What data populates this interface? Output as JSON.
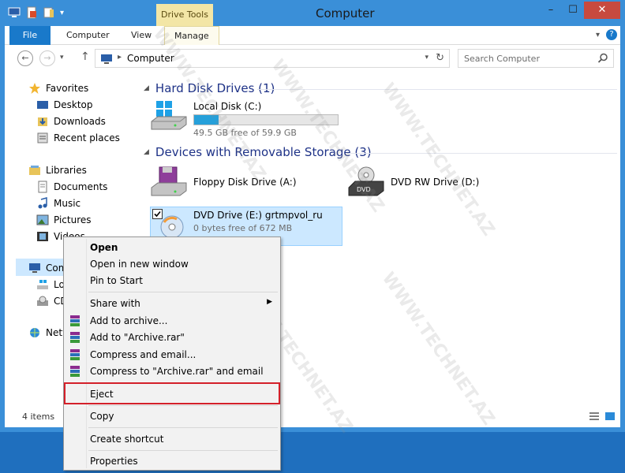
{
  "window": {
    "title": "Computer",
    "contextual_tab": "Drive Tools",
    "controls": {
      "minimize": "–",
      "maximize": "☐",
      "close": "✕"
    }
  },
  "ribbon": {
    "tabs": [
      "File",
      "Computer",
      "View",
      "Manage"
    ],
    "help": "?"
  },
  "address": {
    "path": "Computer",
    "search_placeholder": "Search Computer"
  },
  "sidebar": {
    "items": [
      "Favorites",
      "Desktop",
      "Downloads",
      "Recent places",
      "Libraries",
      "Documents",
      "Music",
      "Pictures",
      "Videos",
      "Comp",
      "Loc",
      "CD",
      "Netw"
    ]
  },
  "content": {
    "hard_disk_group": "Hard Disk Drives (1)",
    "removable_group": "Devices with Removable Storage (3)",
    "local_disk": {
      "name": "Local Disk (C:)",
      "free": "49.5 GB free of 59.9 GB",
      "used_fraction": 0.17
    },
    "floppy": {
      "name": "Floppy Disk Drive (A:)"
    },
    "dvd_rw": {
      "name": "DVD RW Drive (D:)",
      "badge": "DVD"
    },
    "dvd_e": {
      "name": "DVD Drive (E:) grtmpvol_ru",
      "free": "0 bytes free of 672 MB"
    }
  },
  "status": {
    "items": "4 items"
  },
  "context_menu": {
    "items": [
      "Open",
      "Open in new window",
      "Pin to Start",
      "Share with",
      "Add to archive...",
      "Add to \"Archive.rar\"",
      "Compress and email...",
      "Compress to \"Archive.rar\" and email",
      "Eject",
      "Copy",
      "Create shortcut",
      "Properties"
    ]
  },
  "watermark": "WWW.TECHNET.AZ",
  "colors": {
    "accent": "#1979ca",
    "frame": "#3a8fd8",
    "highlight_box": "#d4202a",
    "selection": "#cce8ff"
  }
}
